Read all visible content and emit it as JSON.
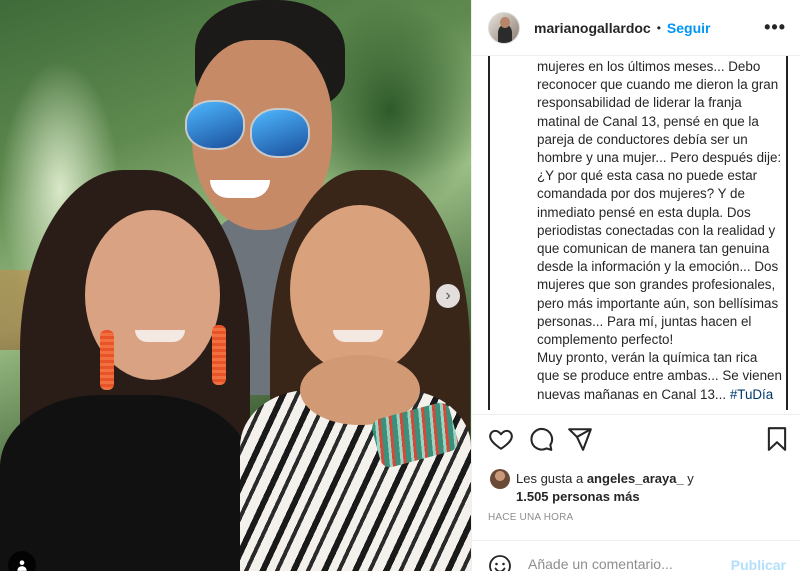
{
  "post": {
    "username": "marianogallardoc",
    "follow_label": "Seguir",
    "separator": "•",
    "more_label": "•••",
    "photo_alt": "Foto de tres personas sonriendo al aire libre"
  },
  "caption": {
    "lines": [
      "mujeres en los últimos meses... Debo",
      "reconocer que cuando me dieron la gran",
      "responsabilidad de liderar la franja",
      "matinal de Canal 13, pensé en que la",
      "pareja de conductores debía ser un",
      "hombre y una mujer... Pero después dije:",
      "¿Y por qué esta casa no puede estar",
      "comandada por dos mujeres? Y de",
      "inmediato pensé en esta dupla. Dos",
      "periodistas conectadas con la realidad y",
      "que comunican de manera tan genuina",
      "desde la información y la emoción... Dos",
      "mujeres que son grandes profesionales,",
      "pero más importante aún, son bellísimas",
      "personas... Para mí, juntas hacen el",
      "complemento perfecto!",
      "Muy pronto, verán la química tan rica",
      "que se produce entre ambas... Se vienen"
    ],
    "last_line_text": "nuevas mañanas en Canal 13... ",
    "hashtag": "#TuDía"
  },
  "likes": {
    "prefix": "Les gusta a ",
    "user": "angeles_araya_",
    "suffix": " y",
    "others": "1.505 personas más"
  },
  "time_ago": "HACE UNA HORA",
  "comment": {
    "placeholder": "Añade un comentario...",
    "publish_label": "Publicar"
  },
  "icons": {
    "like": "heart-icon",
    "comment": "comment-icon",
    "share": "send-icon",
    "save": "bookmark-icon",
    "emoji": "emoji-icon",
    "next": "chevron-right-icon",
    "tag": "user-tag-icon"
  },
  "colors": {
    "follow": "#0095f6",
    "publish_disabled": "#b2dffc",
    "hashtag": "#00376b",
    "muted": "#8e8e8e"
  }
}
